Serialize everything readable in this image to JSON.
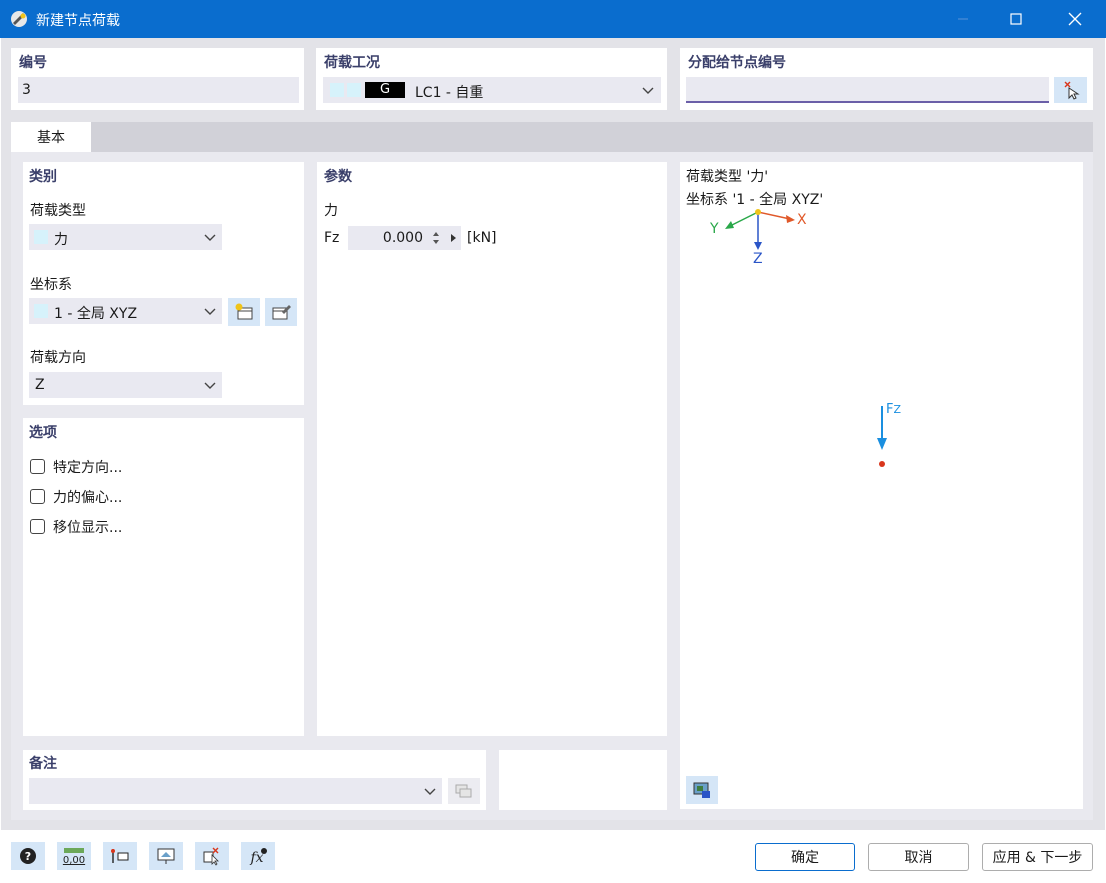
{
  "window": {
    "title": "新建节点荷载"
  },
  "header": {
    "number_label": "编号",
    "number_value": "3",
    "loadcase_label": "荷载工况",
    "loadcase_badge": "G",
    "loadcase_value": "LC1 - 自重",
    "assign_label": "分配给节点编号",
    "assign_value": ""
  },
  "tabs": [
    {
      "label": "基本"
    }
  ],
  "category": {
    "heading": "类别",
    "load_type_label": "荷载类型",
    "load_type_value": "力",
    "coord_label": "坐标系",
    "coord_value": "1 - 全局 XYZ",
    "direction_label": "荷载方向",
    "direction_value": "Z"
  },
  "options": {
    "heading": "选项",
    "items": [
      "特定方向...",
      "力的偏心...",
      "移位显示..."
    ]
  },
  "params": {
    "heading": "参数",
    "force_label": "力",
    "fz_label": "Fz",
    "fz_value": "0.000",
    "fz_unit": "[kN]"
  },
  "preview": {
    "line1": "荷载类型 '力'",
    "line2": "坐标系 '1 - 全局 XYZ'",
    "axis_x": "X",
    "axis_y": "Y",
    "axis_z": "Z",
    "force_label": "F",
    "force_sub": "Z"
  },
  "notes": {
    "label": "备注",
    "value": ""
  },
  "buttons": {
    "ok": "确定",
    "cancel": "取消",
    "apply_next": "应用 & 下一步"
  },
  "colors": {
    "titlebar": "#0a6dce",
    "axis_x": "#e0592a",
    "axis_y": "#2aa84a",
    "axis_z": "#2a55c7",
    "force": "#1a8fe0",
    "node": "#d9361c"
  }
}
